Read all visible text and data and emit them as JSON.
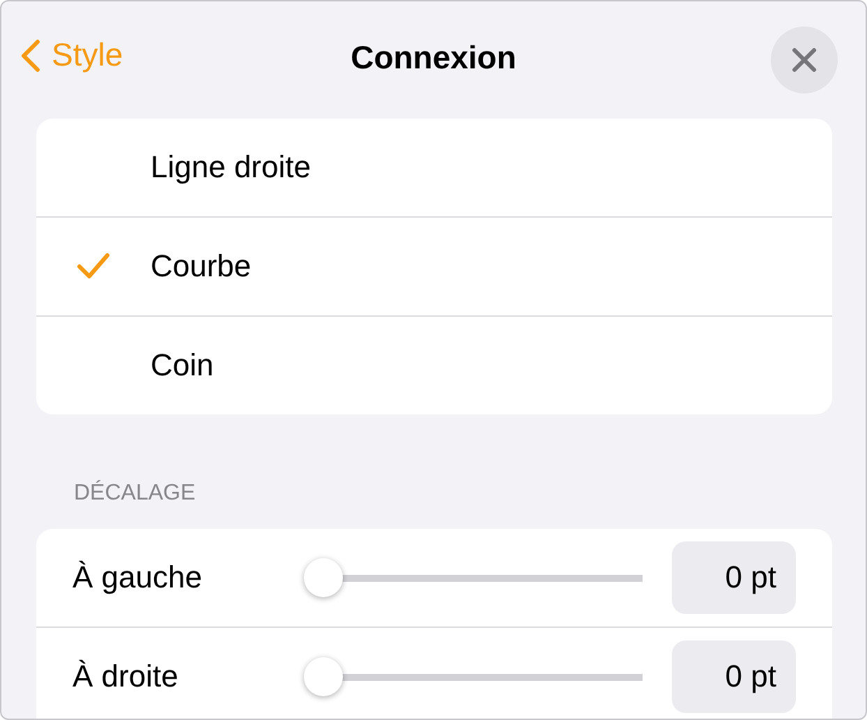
{
  "header": {
    "back_label": "Style",
    "title": "Connexion"
  },
  "connection_types": [
    {
      "label": "Ligne droite",
      "selected": false
    },
    {
      "label": "Courbe",
      "selected": true
    },
    {
      "label": "Coin",
      "selected": false
    }
  ],
  "offset": {
    "section_title": "DÉCALAGE",
    "rows": [
      {
        "label": "À gauche",
        "level": 0,
        "value": "0 pt"
      },
      {
        "label": "À droite",
        "level": 0,
        "value": "0 pt"
      }
    ]
  }
}
